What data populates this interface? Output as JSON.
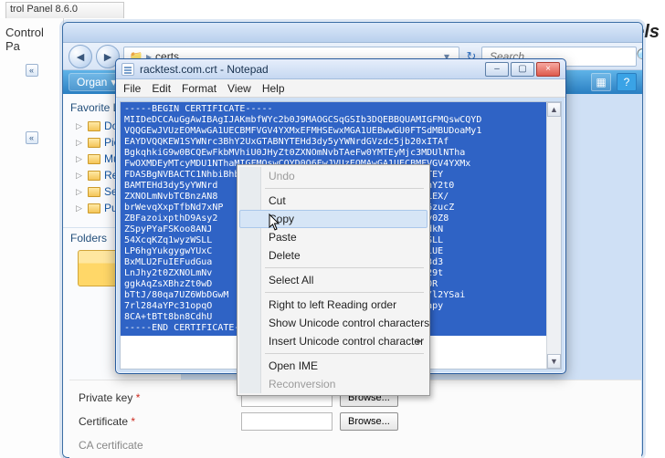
{
  "bg": {
    "cp_title_fragment": "trol Panel 8.6.0",
    "cp_side_label": "Control Pa",
    "brand": "els"
  },
  "explorer": {
    "breadcrumb_root": "certs",
    "search_placeholder": "Search",
    "organize_label": "Organ",
    "tree": {
      "section": "Favorite L",
      "items": [
        "Docur",
        "Pictur",
        "Music",
        "Recen",
        "Searc",
        "Public"
      ],
      "folders_label": "Folders"
    }
  },
  "notepad": {
    "title": "racktest.com.crt - Notepad",
    "menu": [
      "File",
      "Edit",
      "Format",
      "View",
      "Help"
    ],
    "cert_lines": [
      "-----BEGIN CERTIFICATE-----",
      "MIIDeDCCAuGgAwIBAgIJAKmbfWYc2b0J9MAOGCSqGSIb3DQEBBQUAMIGFMQswCQYD",
      "VQQGEwJVUzEOMAwGA1UECBMFVGV4YXMxEFMHSEwxMGA1UEBwwGU0FTSdMBUDoaMy1",
      "EAYDVQQKEW1SYWNrc3BhY2UxGTABNYTEHd3dy5yYWNrdGVzdc5jb20xITAf",
      "BgkqhkiG9w0BCQEwFkbMVhiU0JHyZt0ZXNOmNvbTAeFw0YMTEyMjc3MDUlNTha",
      "FwOXMDEyMTcyMDU1NThaMIGFMQswCQYD0Q6EwJVUzEOMAwGA1UECBMFVGV4YXMx",
      "FDASBgNVBACTC1NhbiBhbmRhIaMFuaMu1ECAsECR6dBAYDVQQLEwZNeTEY",
      "BAMTEHd3dy5yYWNrd                            kBFbW1uQHJhY2t0",
      "ZXNOLmNvbTCBnzAN8                            BNTGOiRAJjLEX/",
      "brWevqXxpTfbNd7xNP                            fBcda6DyW6zucZ",
      "ZBFazoixpthD9Asy2                            cYW3V3gi6Uy0Z8",
      "ZSpyPYaFSKoo8ANJ                            4EFgQU9xC0bdkN",
      "54XcqKZq1wyzWSLL                            xcqKZq1wyzWSLL",
      "LP6hgYukgygwYUxC                            hhczELMBIGA1UE",
      "BxMLU2FuIEFudGua                            CGA1UEAxMQd3d3",
      "LnJhy2t0ZXNOLmNv                            FiA3Rlc3QuY29t",
      "ggkAqZsXBhzZt0wD                            UFAAOBgQDA80R",
      "bTtJ/80qa7UZ6WbDGwM                            muQSW/tY/l2YSai",
      "7rl284aYPc31opqO                            jgZq+rsmR6Mapy",
      "8CA+tBTt8bn8CdhU",
      "-----END CERTIFICATE-----"
    ]
  },
  "context_menu": {
    "items": [
      {
        "label": "Undo",
        "disabled": true
      },
      {
        "sep": true
      },
      {
        "label": "Cut"
      },
      {
        "label": "Copy",
        "hover": true
      },
      {
        "label": "Paste"
      },
      {
        "label": "Delete"
      },
      {
        "sep": true
      },
      {
        "label": "Select All"
      },
      {
        "sep": true
      },
      {
        "label": "Right to left Reading order"
      },
      {
        "label": "Show Unicode control characters"
      },
      {
        "label": "Insert Unicode control character",
        "sub": true
      },
      {
        "sep": true
      },
      {
        "label": "Open IME"
      },
      {
        "label": "Reconversion",
        "disabled": true
      }
    ]
  },
  "form": {
    "private_key_label": "Private key",
    "certificate_label": "Certificate",
    "ca_label": "CA certificate",
    "browse_label": "Browse..."
  }
}
